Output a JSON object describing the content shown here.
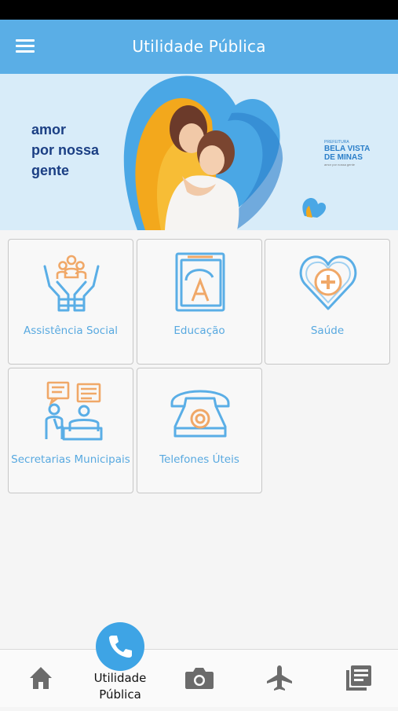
{
  "app": {
    "title": "Utilidade Pública"
  },
  "banner": {
    "line1": "amor",
    "line2": "por nossa",
    "line3": "gente",
    "logo_line1": "PREFEITURA",
    "logo_line2": "BELA VISTA",
    "logo_line3": "DE MINAS",
    "logo_tagline": "amor por nossa gente"
  },
  "tiles": [
    {
      "label": "Assistência Social",
      "icon": "hands-people-icon"
    },
    {
      "label": "Educação",
      "icon": "book-icon"
    },
    {
      "label": "Saúde",
      "icon": "heart-plus-icon"
    },
    {
      "label": "Secretarias Municipais",
      "icon": "office-people-icon"
    },
    {
      "label": "Telefones Úteis",
      "icon": "telephone-icon"
    }
  ],
  "bottom_nav": {
    "active_label_line1": "Utilidade",
    "active_label_line2": "Pública",
    "items": [
      "home-icon",
      "phone-icon",
      "camera-icon",
      "airplane-icon",
      "news-icon"
    ]
  },
  "colors": {
    "primary": "#5aaee6",
    "accent_orange": "#f0a868",
    "fab": "#3ea4e5",
    "nav_icon": "#6b6b6b",
    "banner_text": "#1b3f84"
  }
}
